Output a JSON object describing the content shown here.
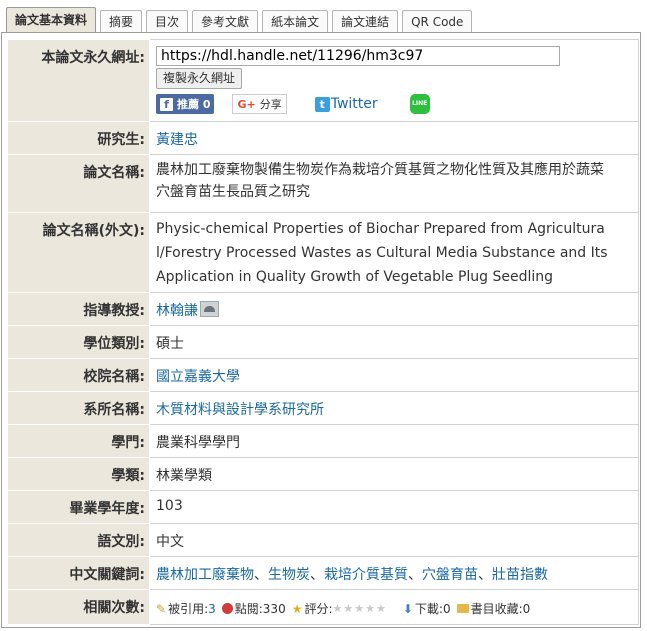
{
  "tabs": [
    "論文基本資料",
    "摘要",
    "目次",
    "參考文獻",
    "紙本論文",
    "論文連結",
    "QR Code"
  ],
  "rows": {
    "permalink": {
      "label": "本論文永久網址:",
      "url": "https://hdl.handle.net/11296/hm3c97",
      "copy_button": "複製永久網址",
      "fb_label": "推薦 0",
      "gplus_label": "分享",
      "twitter_label": "Twitter",
      "line_label": "LINE"
    },
    "student": {
      "label": "研究生:",
      "value": "黃建忠"
    },
    "title": {
      "label": "論文名稱:",
      "value_1": "農林加工廢棄物製備生物炭作為栽培介質基質之物化性質及其應用於蔬菜",
      "value_2": "穴盤育苗生長品質之研究"
    },
    "title_en": {
      "label": "論文名稱(外文):",
      "value_1": "Physic-chemical Properties of Biochar Prepared from Agricultura",
      "value_2": "l/Forestry Processed Wastes as Cultural Media Substance and Its",
      "value_3": "Application in Quality Growth of Vegetable Plug Seedling"
    },
    "advisor": {
      "label": "指導教授:",
      "value": "林翰謙"
    },
    "degree": {
      "label": "學位類別:",
      "value": "碩士"
    },
    "school": {
      "label": "校院名稱:",
      "value": "國立嘉義大學"
    },
    "department": {
      "label": "系所名稱:",
      "value": "木質材料與設計學系研究所"
    },
    "discipline": {
      "label": "學門:",
      "value": "農業科學學門"
    },
    "field": {
      "label": "學類:",
      "value": "林業學類"
    },
    "year": {
      "label": "畢業學年度:",
      "value": "103"
    },
    "language": {
      "label": "語文別:",
      "value": "中文"
    },
    "keywords": {
      "label": "中文關鍵詞:",
      "items": [
        "農林加工廢棄物",
        "生物炭",
        "栽培介質基質",
        "穴盤育苗",
        "壯苗指數"
      ],
      "sep": "、"
    },
    "stats": {
      "label": "相關次數:",
      "cited_label": "被引用:",
      "cited": "3",
      "views_label": "點閱:",
      "views": "330",
      "rating_label": "評分:",
      "downloads_label": "下載:",
      "downloads": "0",
      "bookmarks_label": "書目收藏:",
      "bookmarks": "0"
    }
  },
  "colors": {
    "label_bg": "#ece7dd",
    "link": "#1a6aa0"
  },
  "icons": [
    "facebook-icon",
    "google-plus-icon",
    "twitter-icon",
    "line-icon",
    "advisor-photo-icon",
    "pencil-icon",
    "view-dot-icon",
    "star-icon",
    "download-icon",
    "folder-icon"
  ]
}
